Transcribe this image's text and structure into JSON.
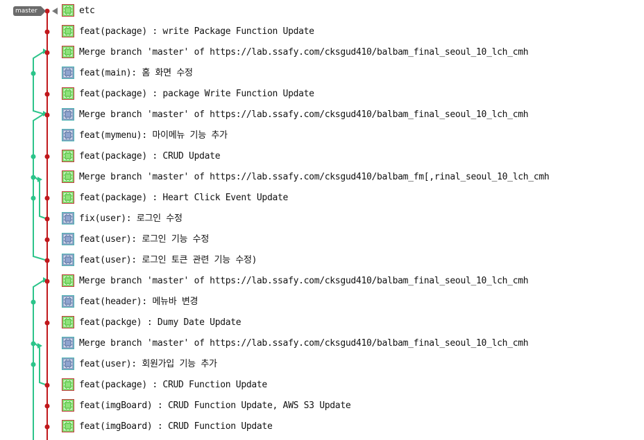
{
  "branch": {
    "label": "master",
    "color_main": "#c0181c",
    "color_side": "#2cc48a",
    "tag_color": "#6b6b6b"
  },
  "commits": [
    {
      "message": "etc",
      "avatar": "green"
    },
    {
      "message": "feat(package) : write Package Function Update",
      "avatar": "green"
    },
    {
      "message": "Merge branch 'master' of https://lab.ssafy.com/cksgud410/balbam_final_seoul_10_lch_cmh",
      "avatar": "green"
    },
    {
      "message": "feat(main): 홈 화면 수정",
      "avatar": "blue"
    },
    {
      "message": "feat(package) : package Write Function Update",
      "avatar": "green"
    },
    {
      "message": "Merge branch 'master' of https://lab.ssafy.com/cksgud410/balbam_final_seoul_10_lch_cmh",
      "avatar": "blue"
    },
    {
      "message": "feat(mymenu): 마이메뉴 기능 추가",
      "avatar": "blue"
    },
    {
      "message": "feat(package) : CRUD Update",
      "avatar": "green"
    },
    {
      "message": "Merge branch 'master' of https://lab.ssafy.com/cksgud410/balbam_fm[,rinal_seoul_10_lch_cmh",
      "avatar": "green"
    },
    {
      "message": "feat(package) : Heart Click Event Update",
      "avatar": "green"
    },
    {
      "message": "fix(user): 로그인 수정",
      "avatar": "blue"
    },
    {
      "message": "feat(user): 로그인 기능 수정",
      "avatar": "blue"
    },
    {
      "message": "feat(user): 로그인 토큰 관련 기능 수정)",
      "avatar": "blue"
    },
    {
      "message": "Merge branch 'master' of https://lab.ssafy.com/cksgud410/balbam_final_seoul_10_lch_cmh",
      "avatar": "green"
    },
    {
      "message": "feat(header): 메뉴바 변경",
      "avatar": "blue"
    },
    {
      "message": "feat(packge) : Dumy Date Update",
      "avatar": "green"
    },
    {
      "message": "Merge branch 'master' of https://lab.ssafy.com/cksgud410/balbam_final_seoul_10_lch_cmh",
      "avatar": "blue"
    },
    {
      "message": "feat(user): 회원가입 기능 추가",
      "avatar": "blue"
    },
    {
      "message": "feat(package) : CRUD Function Update",
      "avatar": "green"
    },
    {
      "message": "feat(imgBoard) : CRUD Function Update, AWS S3 Update",
      "avatar": "green"
    },
    {
      "message": "feat(imgBoard) : CRUD Function Update",
      "avatar": "green"
    }
  ]
}
